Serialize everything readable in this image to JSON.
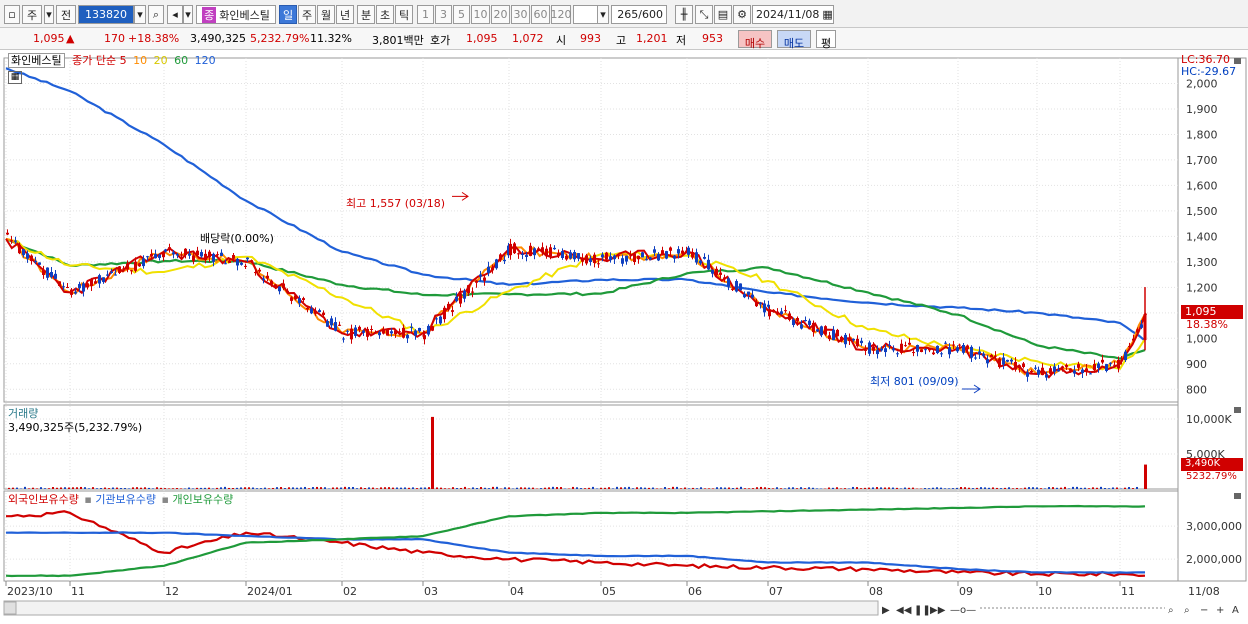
{
  "toolbar": {
    "type1": "주",
    "type2": "전",
    "code": "133820",
    "name_badge": "종",
    "name": "화인베스틸",
    "periods": [
      "일",
      "주",
      "월",
      "년",
      "분",
      "초",
      "틱"
    ],
    "minutes": [
      "1",
      "3",
      "5",
      "10",
      "20",
      "30",
      "60",
      "120"
    ],
    "count": "265",
    "count_total": "/600",
    "date": "2024/11/08"
  },
  "quote": {
    "price": "1,095",
    "up_arrow": "▲",
    "change": "170",
    "change_pct": "+18.38%",
    "volume": "3,490,325",
    "volume_pct": "5,232.79%",
    "turnover": "11.32%",
    "amount": "3,801백만",
    "hoga_label": "호가",
    "ask": "1,095",
    "bid": "1,072",
    "open_label": "시",
    "open": "993",
    "high_label": "고",
    "high": "1,201",
    "low_label": "저",
    "low": "953",
    "buy": "매수",
    "sell": "매도",
    "eval": "평"
  },
  "price_panel": {
    "legend_name": "화인베스틸",
    "legend_ma": "종가 단순",
    "ma_periods": [
      "5",
      "10",
      "20",
      "60",
      "120"
    ],
    "ma_colors": [
      "#d00000",
      "#ff8c00",
      "#f0e000",
      "#1f9a3a",
      "#2060d8"
    ],
    "lc": "LC:36.70",
    "hc": "HC:-29.67",
    "yticks": [
      "2,000",
      "1,900",
      "1,800",
      "1,700",
      "1,600",
      "1,500",
      "1,400",
      "1,300",
      "1,200",
      "1,100",
      "1,000",
      "900",
      "800"
    ],
    "current_price_tag": "1,095",
    "current_pct_tag": "18.38%",
    "ann_high": "최고 1,557 (03/18)",
    "ann_low": "최저 801 (09/09)",
    "ann_div": "배당락(0.00%)"
  },
  "volume_panel": {
    "title": "거래량",
    "value": "3,490,325주(5,232.79%)",
    "yticks": [
      "10,000K",
      "5,000K"
    ],
    "current_tag": "3,490K",
    "current_pct": "5232.79%"
  },
  "holdings_panel": {
    "legend": [
      "외국인보유수량",
      "기관보유수량",
      "개인보유수량"
    ],
    "colors": [
      "#d00000",
      "#2060d8",
      "#1f9a3a"
    ],
    "yticks": [
      "3,000,000",
      "2,000,000"
    ]
  },
  "xaxis": {
    "labels": [
      "2023/10",
      "11",
      "12",
      "2024/01",
      "02",
      "03",
      "04",
      "05",
      "06",
      "07",
      "08",
      "09",
      "10",
      "11"
    ],
    "right_label": "11/08"
  },
  "chart_data": {
    "type": "line",
    "title": "",
    "x": [
      "2023/10",
      "11",
      "12",
      "2024/01",
      "02",
      "03",
      "04",
      "05",
      "06",
      "07",
      "08",
      "09",
      "10",
      "11",
      "11/08"
    ],
    "xlabel": "",
    "ylabel": "",
    "ylim": [
      750,
      2100
    ],
    "series": [
      {
        "name": "종가",
        "values": [
          1390,
          1180,
          1340,
          1300,
          1020,
          1020,
          1350,
          1310,
          1340,
          1110,
          960,
          960,
          860,
          900,
          1095
        ]
      },
      {
        "name": "120",
        "values": [
          2060,
          1970,
          1760,
          1540,
          1340,
          1250,
          1210,
          1230,
          1230,
          1180,
          1140,
          1120,
          1100,
          1060,
          990
        ]
      }
    ],
    "volume_series": {
      "name": "거래량",
      "ylim": [
        0,
        12000
      ],
      "annotations": [
        {
          "x": "03",
          "value": 10300
        },
        {
          "x": "11/08",
          "value": 3490
        }
      ]
    },
    "holdings_series": [
      {
        "name": "외국인보유수량",
        "values": [
          3300000,
          3400000,
          2200000,
          2800000,
          2500000,
          2200000,
          2000000,
          1900000,
          1800000,
          1750000,
          1700000,
          1600000,
          1550000,
          1550000,
          1500000
        ]
      },
      {
        "name": "기관보유수량",
        "values": [
          2800000,
          2800000,
          2800000,
          2700000,
          2600000,
          2600000,
          2200000,
          2100000,
          2100000,
          1900000,
          1900000,
          1700000,
          1600000,
          1600000,
          1600000
        ]
      },
      {
        "name": "개인보유수량",
        "values": [
          1500000,
          1500000,
          1800000,
          2500000,
          2600000,
          2700000,
          3300000,
          3400000,
          3400000,
          3450000,
          3500000,
          3550000,
          3600000,
          3600000,
          3600000
        ]
      }
    ]
  }
}
